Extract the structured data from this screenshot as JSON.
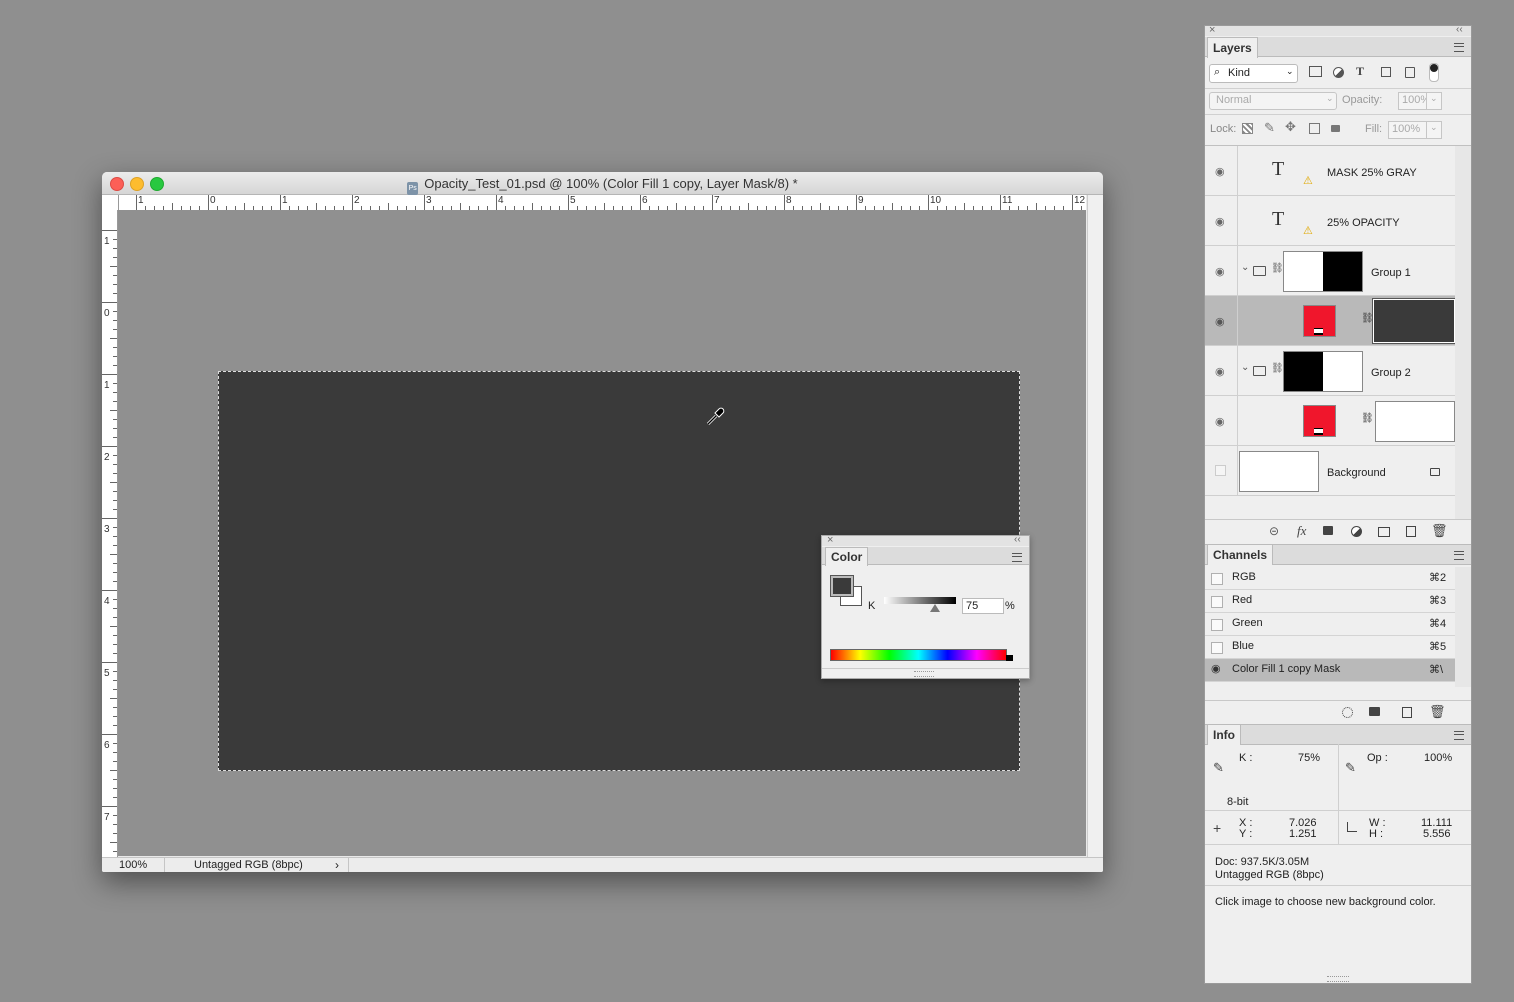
{
  "document": {
    "title": "Opacity_Test_01.psd @ 100% (Color Fill 1 copy, Layer Mask/8) *",
    "icon": "Ps",
    "ruler_h": [
      "1",
      "0",
      "1",
      "2",
      "3",
      "4",
      "5",
      "6",
      "7",
      "8",
      "9",
      "10",
      "11",
      "12"
    ],
    "ruler_v": [
      "1",
      "0",
      "1",
      "2",
      "3",
      "4",
      "5",
      "6",
      "7"
    ],
    "zoom": "100%",
    "profile": "Untagged RGB (8bpc)",
    "status_arrow": "›"
  },
  "color_panel": {
    "tab": "Color",
    "channel_label": "K",
    "value": "75",
    "unit": "%",
    "foreground": "#3a3a3a",
    "background": "#ffffff"
  },
  "layers_panel": {
    "tab": "Layers",
    "filter_kind": "Kind",
    "blend_mode": "Normal",
    "opacity_label": "Opacity:",
    "opacity_value": "100%",
    "lock_label": "Lock:",
    "fill_label": "Fill:",
    "fill_value": "100%",
    "layers": [
      {
        "name": "MASK 25% GRAY",
        "kind": "text",
        "thumb": "T"
      },
      {
        "name": "25% OPACITY",
        "kind": "text",
        "thumb": "T"
      },
      {
        "name": "Group 1",
        "kind": "group"
      },
      {
        "name": "",
        "kind": "fill",
        "selected": true
      },
      {
        "name": "Group 2",
        "kind": "group"
      },
      {
        "name": "",
        "kind": "fill"
      },
      {
        "name": "Background",
        "kind": "background"
      }
    ]
  },
  "channels_panel": {
    "tab": "Channels",
    "channels": [
      {
        "name": "RGB",
        "shortcut": "⌘2"
      },
      {
        "name": "Red",
        "shortcut": "⌘3"
      },
      {
        "name": "Green",
        "shortcut": "⌘4"
      },
      {
        "name": "Blue",
        "shortcut": "⌘5"
      },
      {
        "name": "Color Fill 1 copy Mask",
        "shortcut": "⌘\\"
      }
    ]
  },
  "info_panel": {
    "tab": "Info",
    "k_label": "K :",
    "k_value": "75%",
    "op_label": "Op :",
    "op_value": "100%",
    "bit_depth": "8-bit",
    "x_label": "X :",
    "x_value": "7.026",
    "y_label": "Y :",
    "y_value": "1.251",
    "w_label": "W :",
    "w_value": "11.111",
    "h_label": "H :",
    "h_value": "5.556",
    "doc_size": "Doc: 937.5K/3.05M",
    "profile": "Untagged RGB (8bpc)",
    "hint": "Click image to choose new background color."
  },
  "colors": {
    "selection_red": "#f0162c",
    "canvas_fill": "#3a3a3a",
    "selected_row": "#b9b9b9"
  }
}
